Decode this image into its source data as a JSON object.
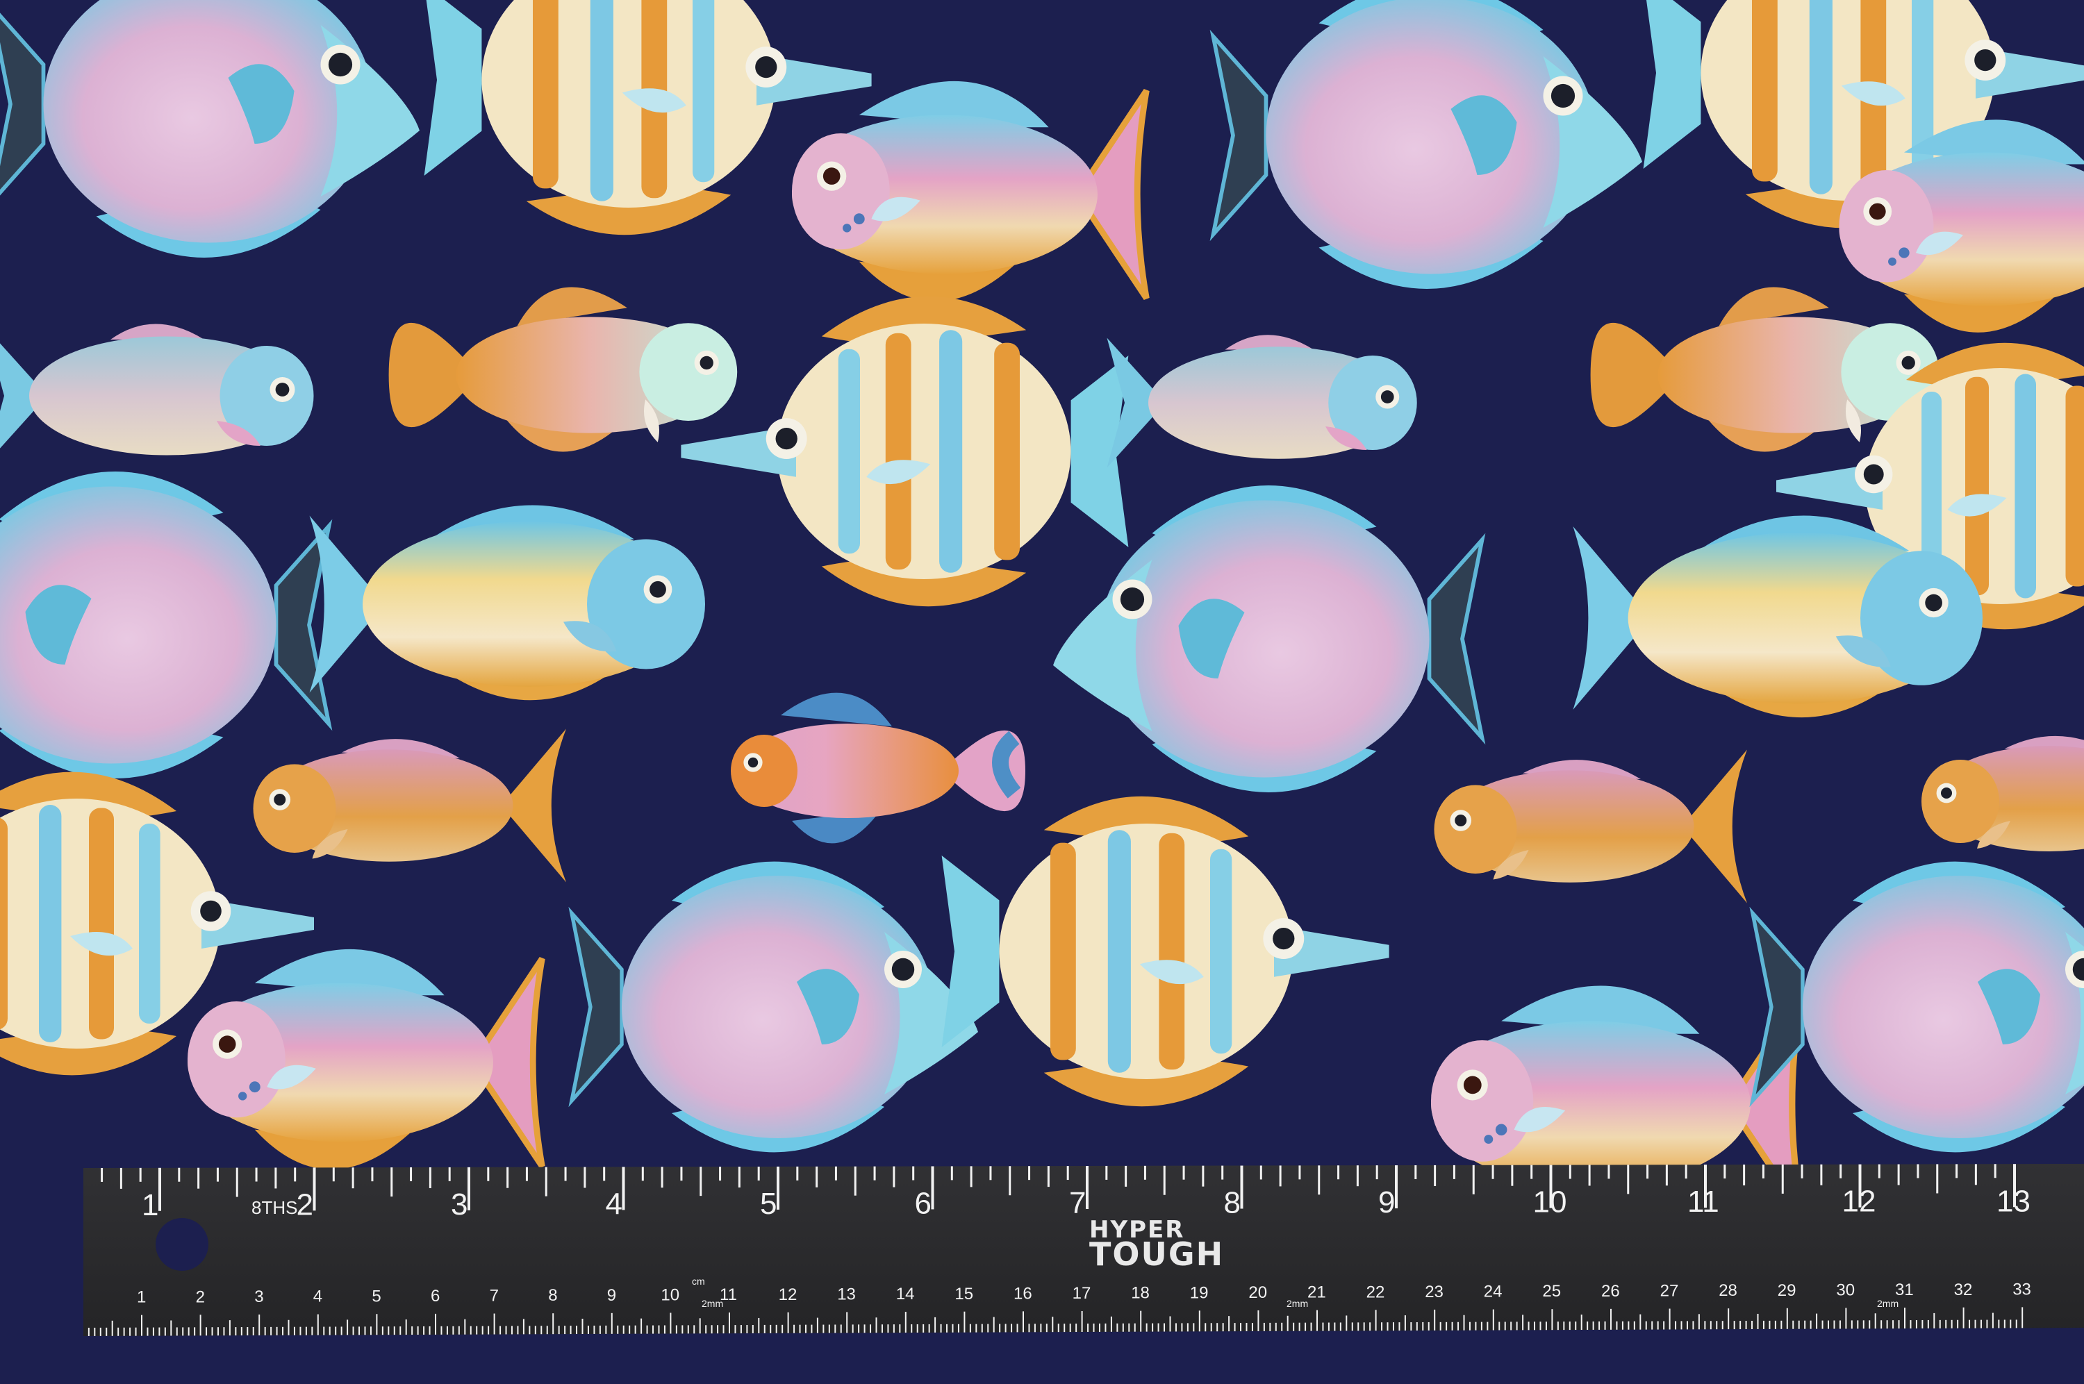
{
  "ruler": {
    "brand_top": "HYPER",
    "brand_bottom": "TOUGH",
    "eighths_label": "8THS",
    "inch_labels": [
      "1",
      "2",
      "3",
      "4",
      "5",
      "6",
      "7",
      "8",
      "9",
      "10",
      "11",
      "12",
      "13"
    ],
    "cm_label": "cm",
    "mm_label": "2mm",
    "cm_labels": [
      "1",
      "2",
      "3",
      "4",
      "5",
      "6",
      "7",
      "8",
      "9",
      "10",
      "11",
      "12",
      "13",
      "14",
      "15",
      "16",
      "17",
      "18",
      "19",
      "20",
      "21",
      "22",
      "23",
      "24",
      "25",
      "26",
      "27",
      "28",
      "29",
      "30",
      "31",
      "32",
      "33"
    ]
  },
  "colors": {
    "fabric": "#1c1f4f",
    "ruler": "#2a2a2c",
    "ruler_marks": "#f2f2f2",
    "fish_blue": "#6ec8e6",
    "fish_pink": "#e6a2c3",
    "fish_orange": "#e9a03c",
    "fish_cream": "#f3e6c4"
  },
  "fish": [
    {
      "kind": "round-tang",
      "palette": "blue-pink",
      "facing": "right"
    },
    {
      "kind": "butterfly",
      "palette": "orange-stripe",
      "facing": "right"
    },
    {
      "kind": "wrasse",
      "palette": "pink-gold",
      "facing": "left"
    },
    {
      "kind": "round-tang",
      "palette": "blue-pink",
      "facing": "right"
    },
    {
      "kind": "butterfly",
      "palette": "orange-stripe",
      "facing": "right"
    },
    {
      "kind": "wrasse",
      "palette": "pink-gold",
      "facing": "left"
    },
    {
      "kind": "minnow",
      "palette": "blue-scaled",
      "facing": "right"
    },
    {
      "kind": "killifish",
      "palette": "orange-mint",
      "facing": "right"
    },
    {
      "kind": "butterfly",
      "palette": "pink-blue-stripe",
      "facing": "left"
    },
    {
      "kind": "minnow",
      "palette": "blue-scaled",
      "facing": "right"
    },
    {
      "kind": "killifish",
      "palette": "orange-mint",
      "facing": "right"
    },
    {
      "kind": "butterfly",
      "palette": "pink-blue-stripe",
      "facing": "left"
    },
    {
      "kind": "round-tang",
      "palette": "orange-pink",
      "facing": "left"
    },
    {
      "kind": "surgeon",
      "palette": "blue-yellow",
      "facing": "right"
    },
    {
      "kind": "round-tang",
      "palette": "orange-pink",
      "facing": "left"
    },
    {
      "kind": "surgeon",
      "palette": "blue-yellow",
      "facing": "right"
    },
    {
      "kind": "anthias",
      "palette": "orange",
      "facing": "left"
    },
    {
      "kind": "guppy",
      "palette": "pink-blue",
      "facing": "left"
    },
    {
      "kind": "anthias",
      "palette": "orange",
      "facing": "left"
    },
    {
      "kind": "anthias",
      "palette": "orange",
      "facing": "left"
    },
    {
      "kind": "butterfly",
      "palette": "orange-stripe",
      "facing": "right"
    },
    {
      "kind": "round-tang",
      "palette": "blue-pink",
      "facing": "right"
    },
    {
      "kind": "butterfly",
      "palette": "orange-stripe",
      "facing": "right"
    },
    {
      "kind": "wrasse",
      "palette": "pink-gold",
      "facing": "left"
    },
    {
      "kind": "wrasse",
      "palette": "pink-gold",
      "facing": "left"
    },
    {
      "kind": "round-tang",
      "palette": "blue-pink",
      "facing": "right"
    }
  ]
}
